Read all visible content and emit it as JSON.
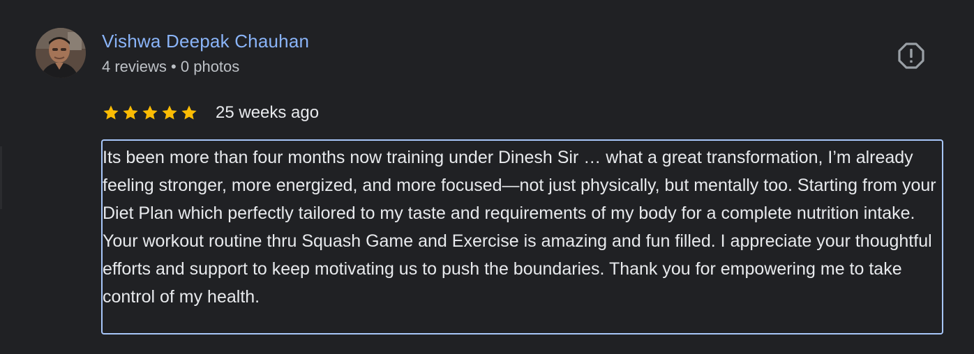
{
  "reviewer": {
    "name": "Vishwa Deepak Chauhan",
    "reviews_label": "4 reviews",
    "separator": "•",
    "photos_label": "0 photos"
  },
  "rating": {
    "stars": 5,
    "max_stars": 5,
    "star_color": "#fbbc04",
    "icon": "star-icon"
  },
  "review": {
    "date": "25 weeks ago",
    "text": "Its been more than four months now training under Dinesh Sir … what a great transformation, I’m already feeling stronger, more energized, and more focused—not just physically, but mentally too. Starting from your Diet Plan which perfectly tailored to my taste and requirements of my body for a complete nutrition intake. Your workout routine thru Squash Game and Exercise is amazing and fun filled. I appreciate your thoughtful efforts and support to keep motivating us to push the boundaries. Thank you for empowering me to take control of my health."
  },
  "actions": {
    "report_icon": "report-icon"
  },
  "colors": {
    "background": "#202124",
    "name_link": "#8ab4f8",
    "focus_outline": "#a8c7fa",
    "text": "#e8eaed",
    "secondary_text": "#bdc1c6"
  }
}
